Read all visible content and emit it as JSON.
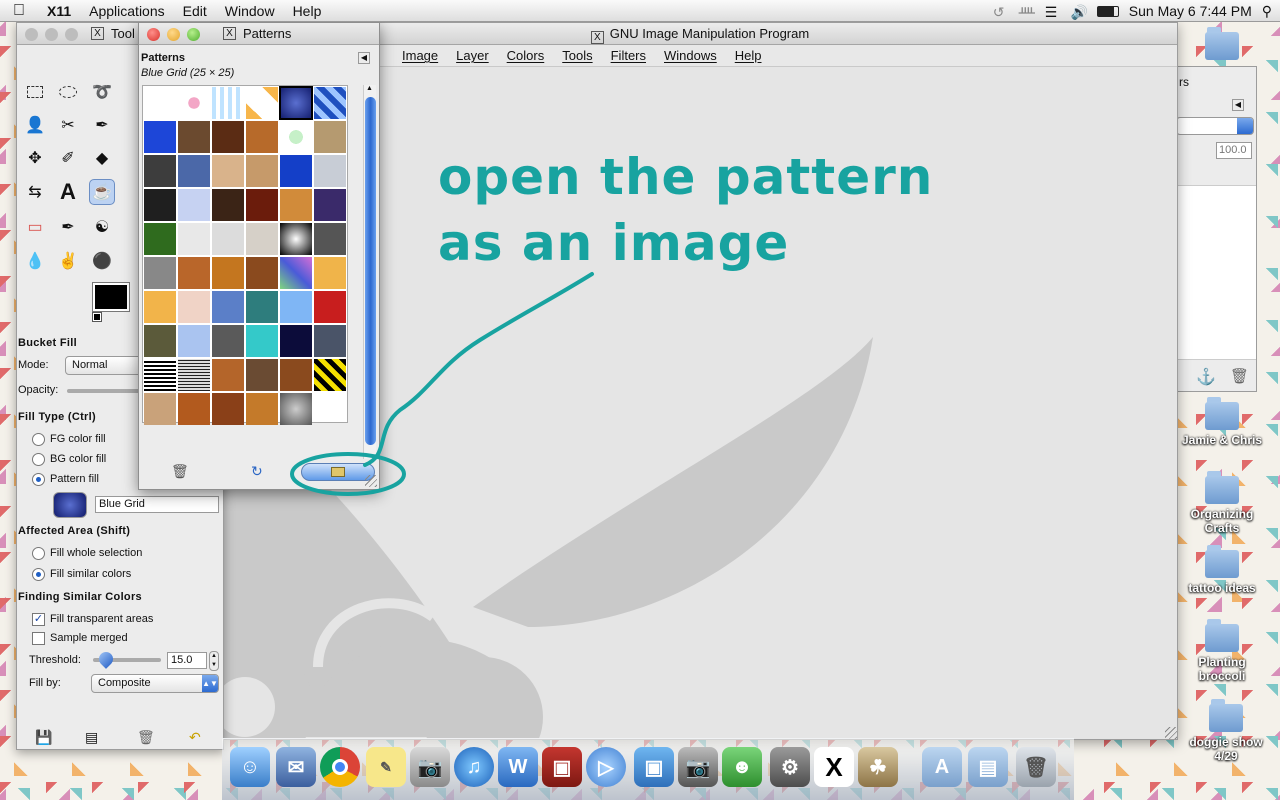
{
  "menubar": {
    "app": "X11",
    "items": [
      "Applications",
      "Edit",
      "Window",
      "Help"
    ],
    "clock": "Sun May 6  7:44 PM"
  },
  "image_window": {
    "title": "GNU Image Manipulation Program",
    "menus": [
      "Image",
      "Layer",
      "Colors",
      "Tools",
      "Filters",
      "Windows",
      "Help"
    ]
  },
  "annotation": {
    "line1": "open the pattern",
    "line2": "as an image",
    "color": "#18a3a0"
  },
  "toolbox": {
    "title": "Tool",
    "tool_options_title": "Bucket Fill",
    "mode_label": "Mode:",
    "mode_value": "Normal",
    "opacity_label": "Opacity:",
    "fill_type_label": "Fill Type  (Ctrl)",
    "fill_options": [
      "FG color fill",
      "BG color fill",
      "Pattern fill"
    ],
    "fill_selected": "Pattern fill",
    "pattern_name": "Blue Grid",
    "affected_area_label": "Affected Area  (Shift)",
    "area_options": [
      "Fill whole selection",
      "Fill similar colors"
    ],
    "area_selected": "Fill similar colors",
    "similar_colors_label": "Finding Similar Colors",
    "fill_transparent_label": "Fill transparent areas",
    "fill_transparent_checked": true,
    "sample_merged_label": "Sample merged",
    "sample_merged_checked": false,
    "threshold_label": "Threshold:",
    "threshold_value": "15.0",
    "fill_by_label": "Fill by:",
    "fill_by_value": "Composite"
  },
  "patterns_window": {
    "title": "Patterns",
    "panel_label": "Patterns",
    "selected_info": "Blue Grid (25 × 25)"
  },
  "dock_panel": {
    "opacity_value": "100.0",
    "partial_title": "rs"
  },
  "desktop_folders": [
    {
      "label": "Jamie & Chris"
    },
    {
      "label": "Organizing Crafts"
    },
    {
      "label": "tattoo ideas"
    },
    {
      "label": "Planting broccoli"
    },
    {
      "label": "doggie show 4/29"
    }
  ]
}
